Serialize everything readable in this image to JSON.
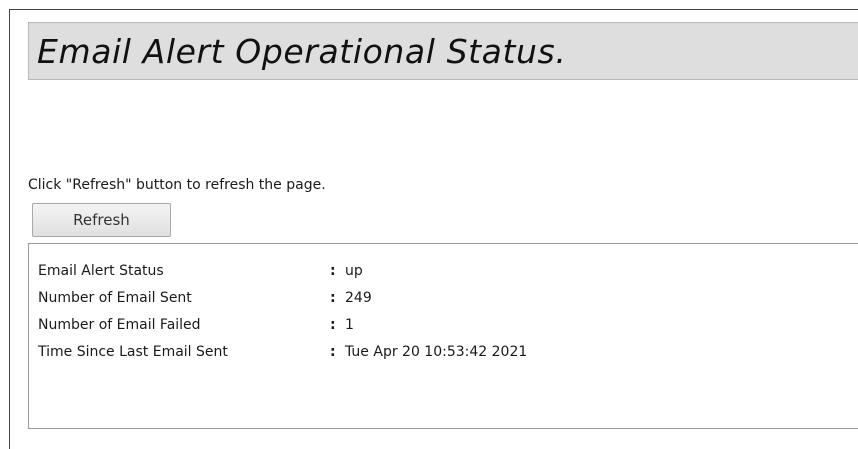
{
  "page": {
    "title": "Email Alert Operational Status.",
    "instruction": "Click \"Refresh\" button to refresh the page.",
    "refresh_label": "Refresh"
  },
  "status": {
    "separator": ":",
    "rows": [
      {
        "label": "Email Alert Status",
        "value": "up"
      },
      {
        "label": "Number of Email Sent",
        "value": "249"
      },
      {
        "label": "Number of Email Failed",
        "value": "1"
      },
      {
        "label": "Time Since Last Email Sent",
        "value": "Tue Apr 20 10:53:42 2021"
      }
    ]
  }
}
